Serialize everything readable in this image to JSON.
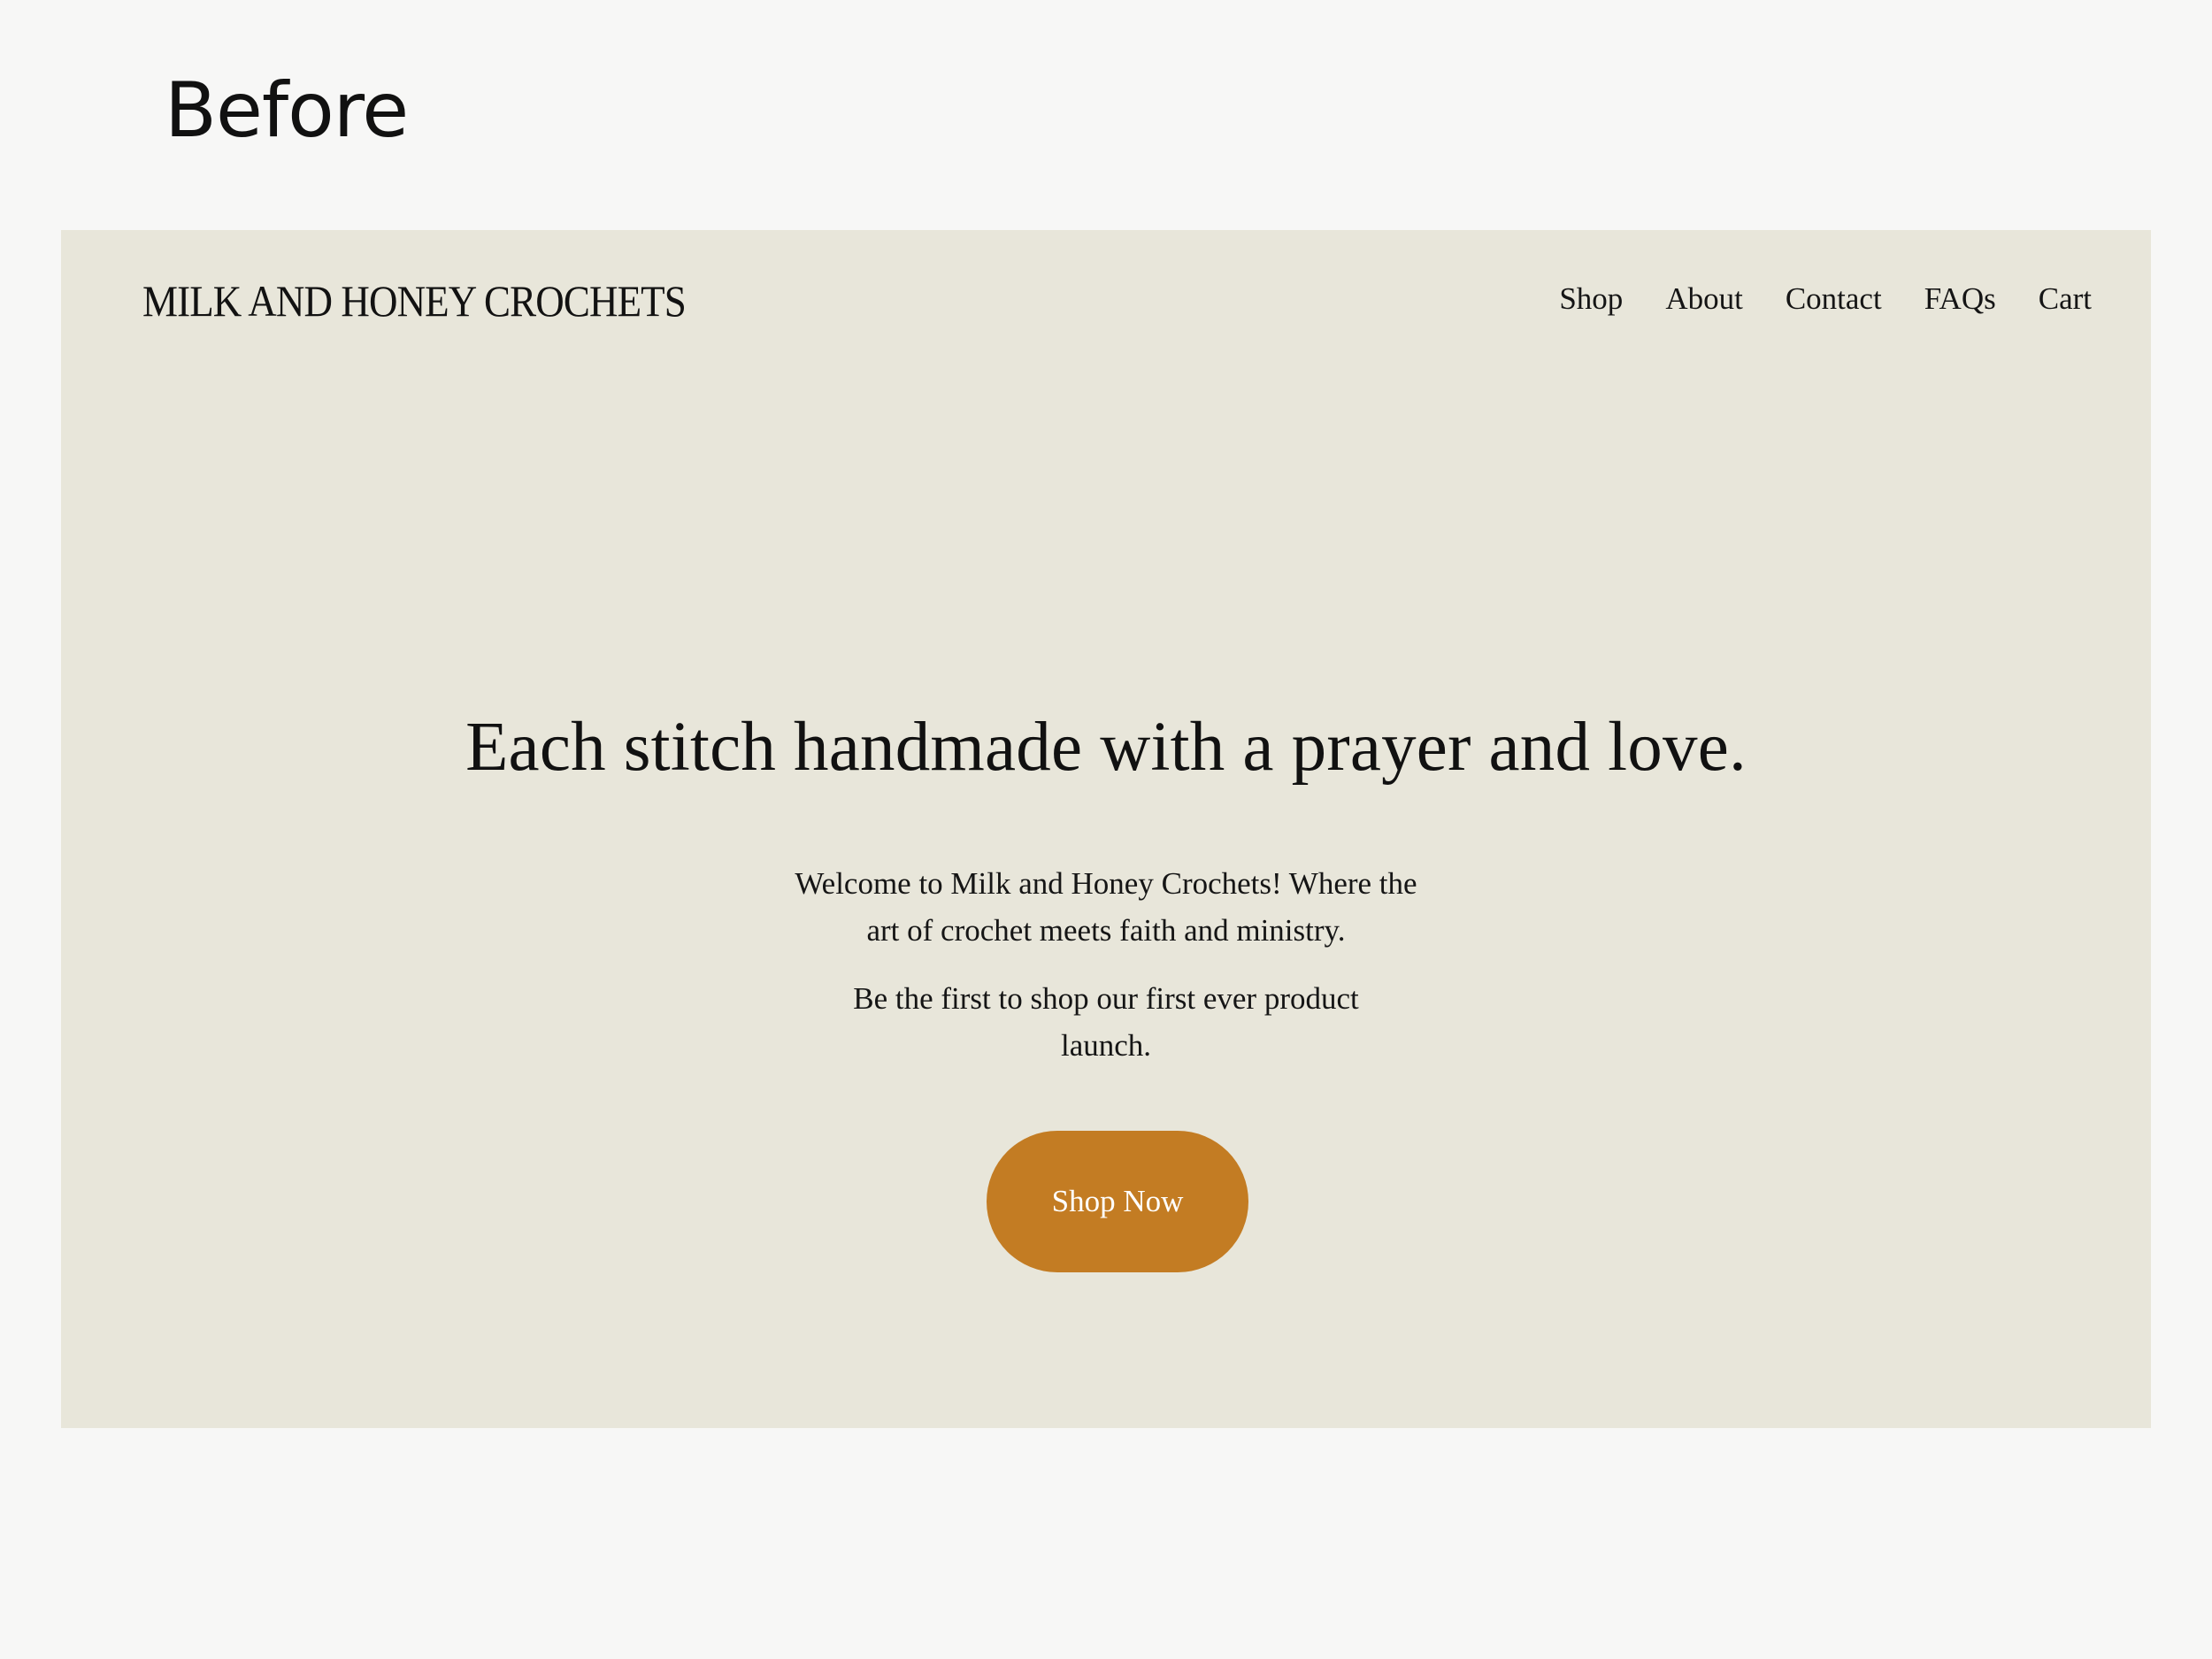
{
  "caption": "Before",
  "header": {
    "logo": "MILK AND HONEY CROCHETS",
    "nav": [
      "Shop",
      "About",
      "Contact",
      "FAQs",
      "Cart"
    ]
  },
  "hero": {
    "headline": "Each stitch handmade with a prayer and love.",
    "intro": "Welcome to Milk and Honey Crochets! Where the art of crochet meets faith and ministry.",
    "launch": "Be the first to shop our first ever product launch.",
    "cta_label": "Shop Now"
  },
  "colors": {
    "page_background": "#f7f7f6",
    "site_background": "#e8e6da",
    "accent": "#c37c23",
    "text": "#111111"
  }
}
